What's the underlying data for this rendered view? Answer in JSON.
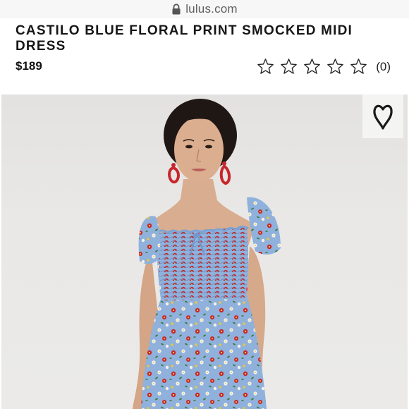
{
  "browser": {
    "domain": "lulus.com"
  },
  "product": {
    "title": "CASTILO BLUE FLORAL PRINT SMOCKED MIDI DRESS",
    "price": "$189",
    "rating": {
      "stars_filled": 0,
      "stars_total": 5,
      "review_count": "(0)"
    },
    "image_alt": "Model wearing the Castilo blue floral print smocked midi dress"
  },
  "icons": {
    "lock": "lock-icon",
    "star": "star-outline-icon",
    "favorite": "heart-icon"
  },
  "colors": {
    "dress_blue": "#8fb1dc",
    "earring_red": "#c8262c",
    "background": "#e8e7e5"
  }
}
